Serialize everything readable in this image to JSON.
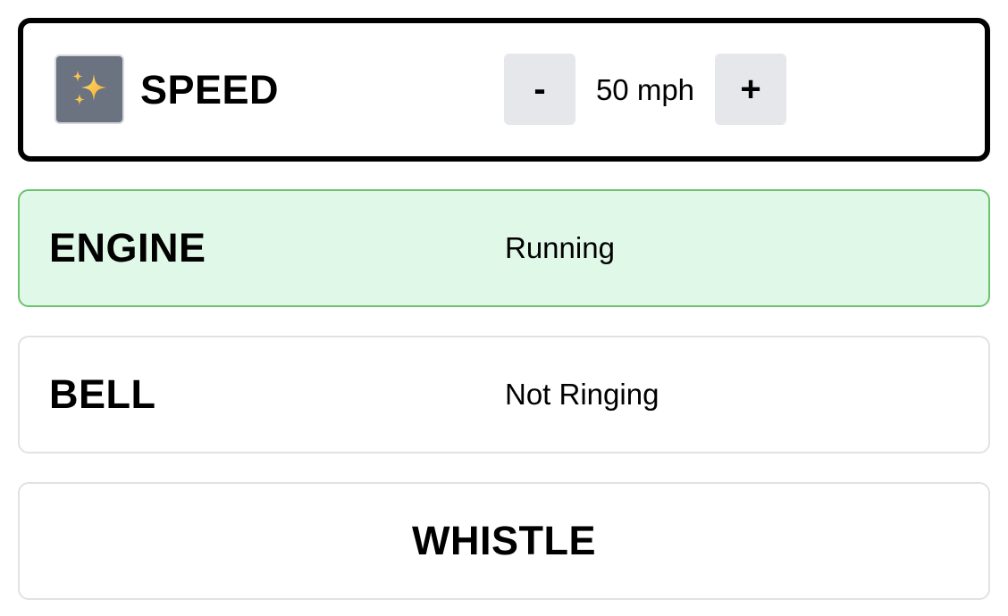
{
  "speed": {
    "icon": "sparkles-icon",
    "title": "SPEED",
    "decrement_label": "-",
    "value": "50 mph",
    "increment_label": "+"
  },
  "engine": {
    "title": "ENGINE",
    "status": "Running",
    "status_color": "#e0f8e8",
    "border_color": "#6cc26f"
  },
  "bell": {
    "title": "BELL",
    "status": "Not Ringing"
  },
  "whistle": {
    "title": "WHISTLE"
  }
}
